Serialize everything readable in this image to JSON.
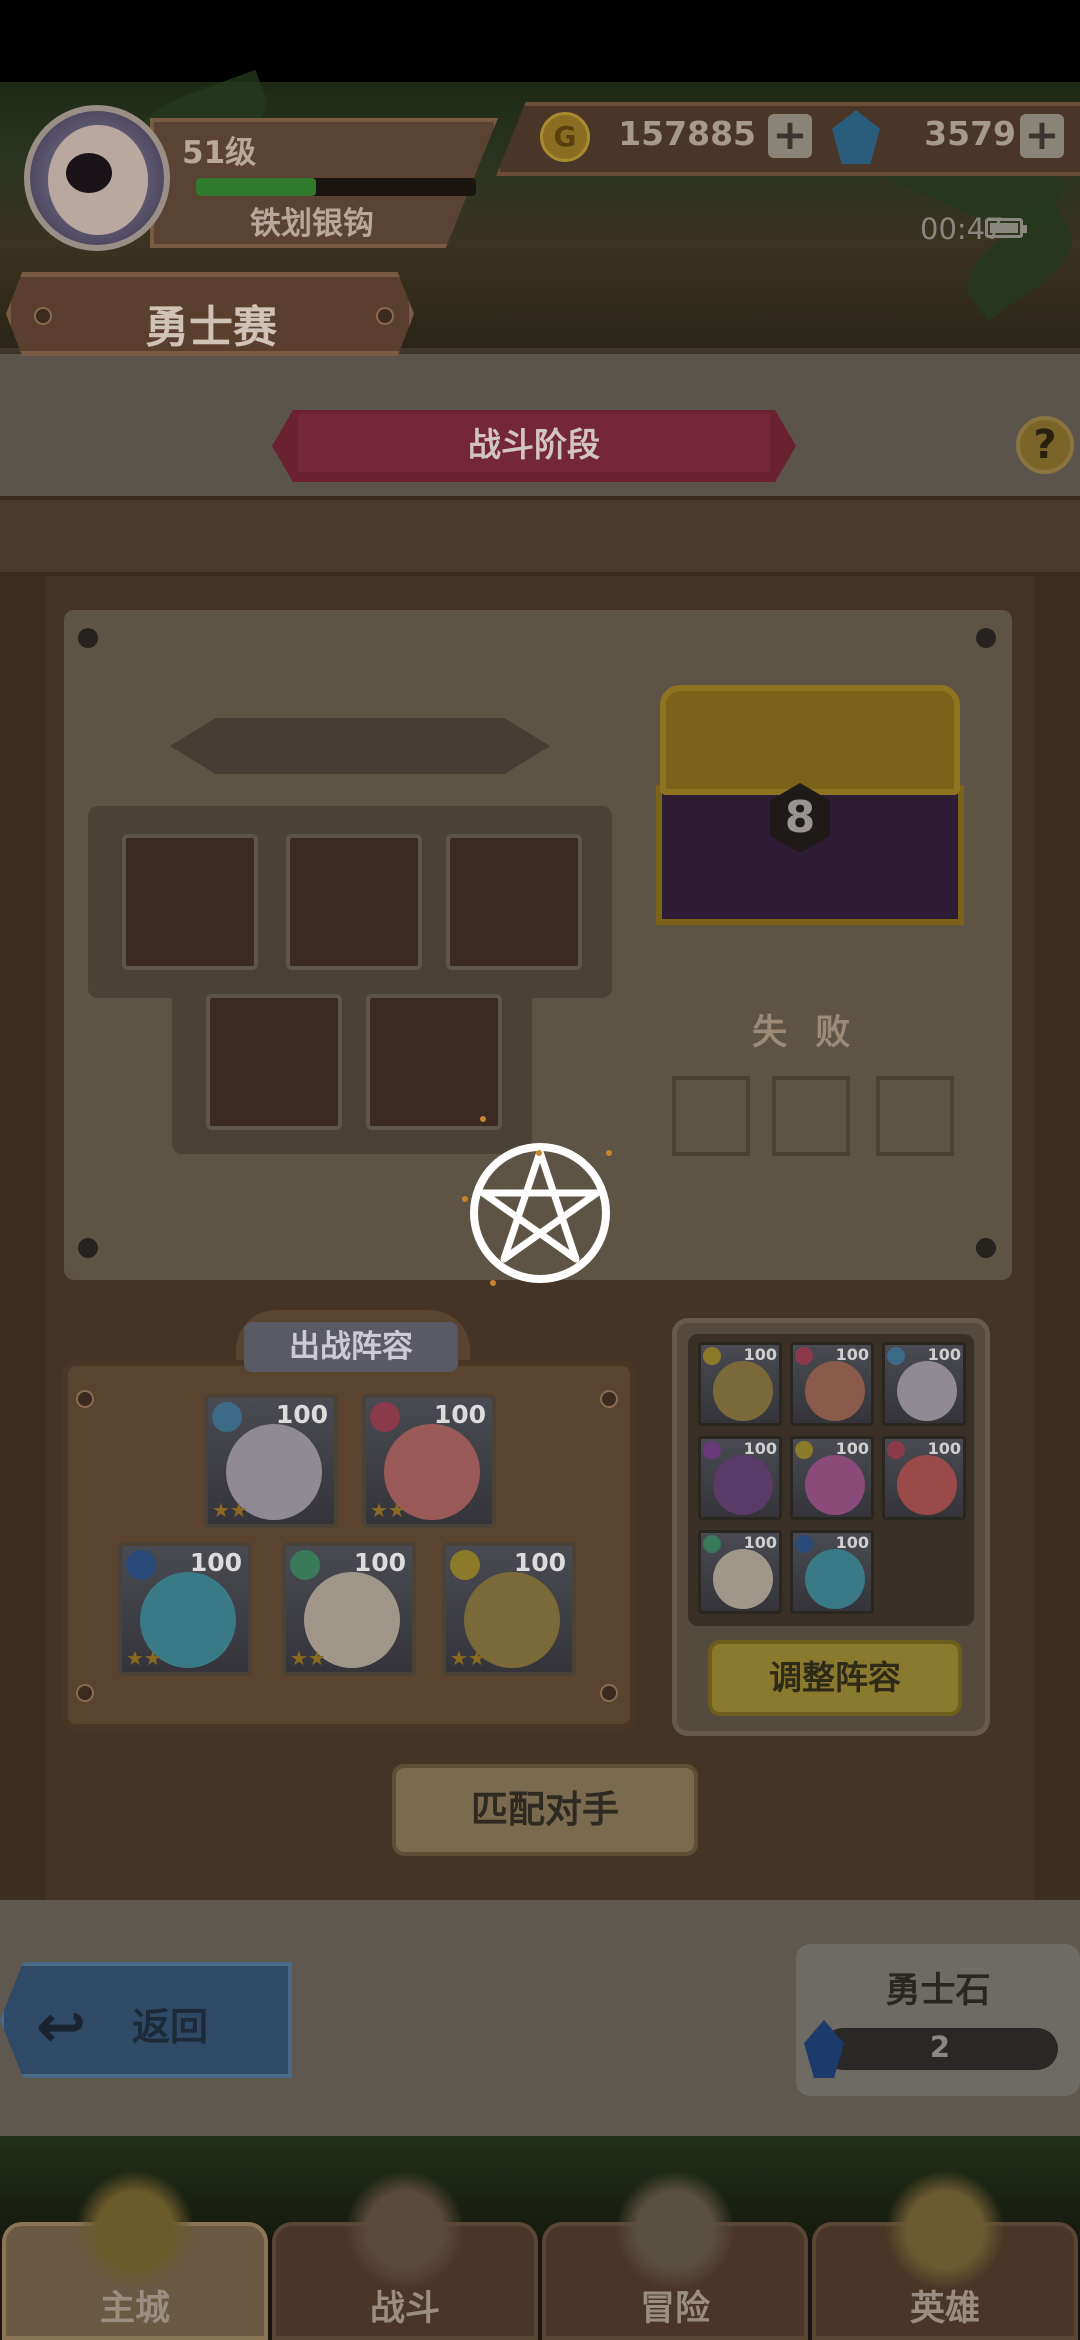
{
  "player": {
    "level": "51级",
    "name": "铁划银钩",
    "xp_fraction": 0.43
  },
  "resources": {
    "coins": "157885",
    "gems": "3579",
    "coin_glyph": "G"
  },
  "status_bar": {
    "time": "00:47"
  },
  "screen": {
    "title": "勇士赛",
    "stage": "战斗阶段",
    "help_glyph": "?"
  },
  "arena": {
    "chest_level": "8",
    "result_status": "失 败",
    "enemy_slots": 5,
    "result_slots": 3
  },
  "lineup": {
    "label": "出战阵容",
    "heroes": [
      {
        "level": "100",
        "class_color": "#3d6a86",
        "face": "#8f8a94"
      },
      {
        "level": "100",
        "class_color": "#8a3a4a",
        "face": "#9a5a58"
      },
      {
        "level": "100",
        "class_color": "#2a4a7a",
        "face": "#3a7a86"
      },
      {
        "level": "100",
        "class_color": "#3a7a5a",
        "face": "#a0968a"
      },
      {
        "level": "100",
        "class_color": "#8a7a2a",
        "face": "#7a6a3a"
      }
    ]
  },
  "roster": {
    "heroes": [
      {
        "level": "100",
        "class_color": "#8a7a2a",
        "face": "#7a6a3a"
      },
      {
        "level": "100",
        "class_color": "#8a3a4a",
        "face": "#8a5a4a"
      },
      {
        "level": "100",
        "class_color": "#3d6a86",
        "face": "#8f8a94"
      },
      {
        "level": "100",
        "class_color": "#6a3a7a",
        "face": "#5a3a66"
      },
      {
        "level": "100",
        "class_color": "#8a7a2a",
        "face": "#8a4a7a"
      },
      {
        "level": "100",
        "class_color": "#8a3a4a",
        "face": "#9a4a48"
      },
      {
        "level": "100",
        "class_color": "#3a7a5a",
        "face": "#a0968a"
      },
      {
        "level": "100",
        "class_color": "#2a4a7a",
        "face": "#3a7a86"
      }
    ],
    "adjust_button": "调整阵容"
  },
  "match_button": "匹配对手",
  "back_button": "返回",
  "warrior_stone": {
    "label": "勇士石",
    "count": "2"
  },
  "nav": {
    "tabs": [
      "主城",
      "战斗",
      "冒险",
      "英雄"
    ],
    "active": 0
  },
  "colors": {
    "ribbon": "#6a2232",
    "gold_button": "#8a7a2e",
    "back_button": "#2e4a66"
  }
}
